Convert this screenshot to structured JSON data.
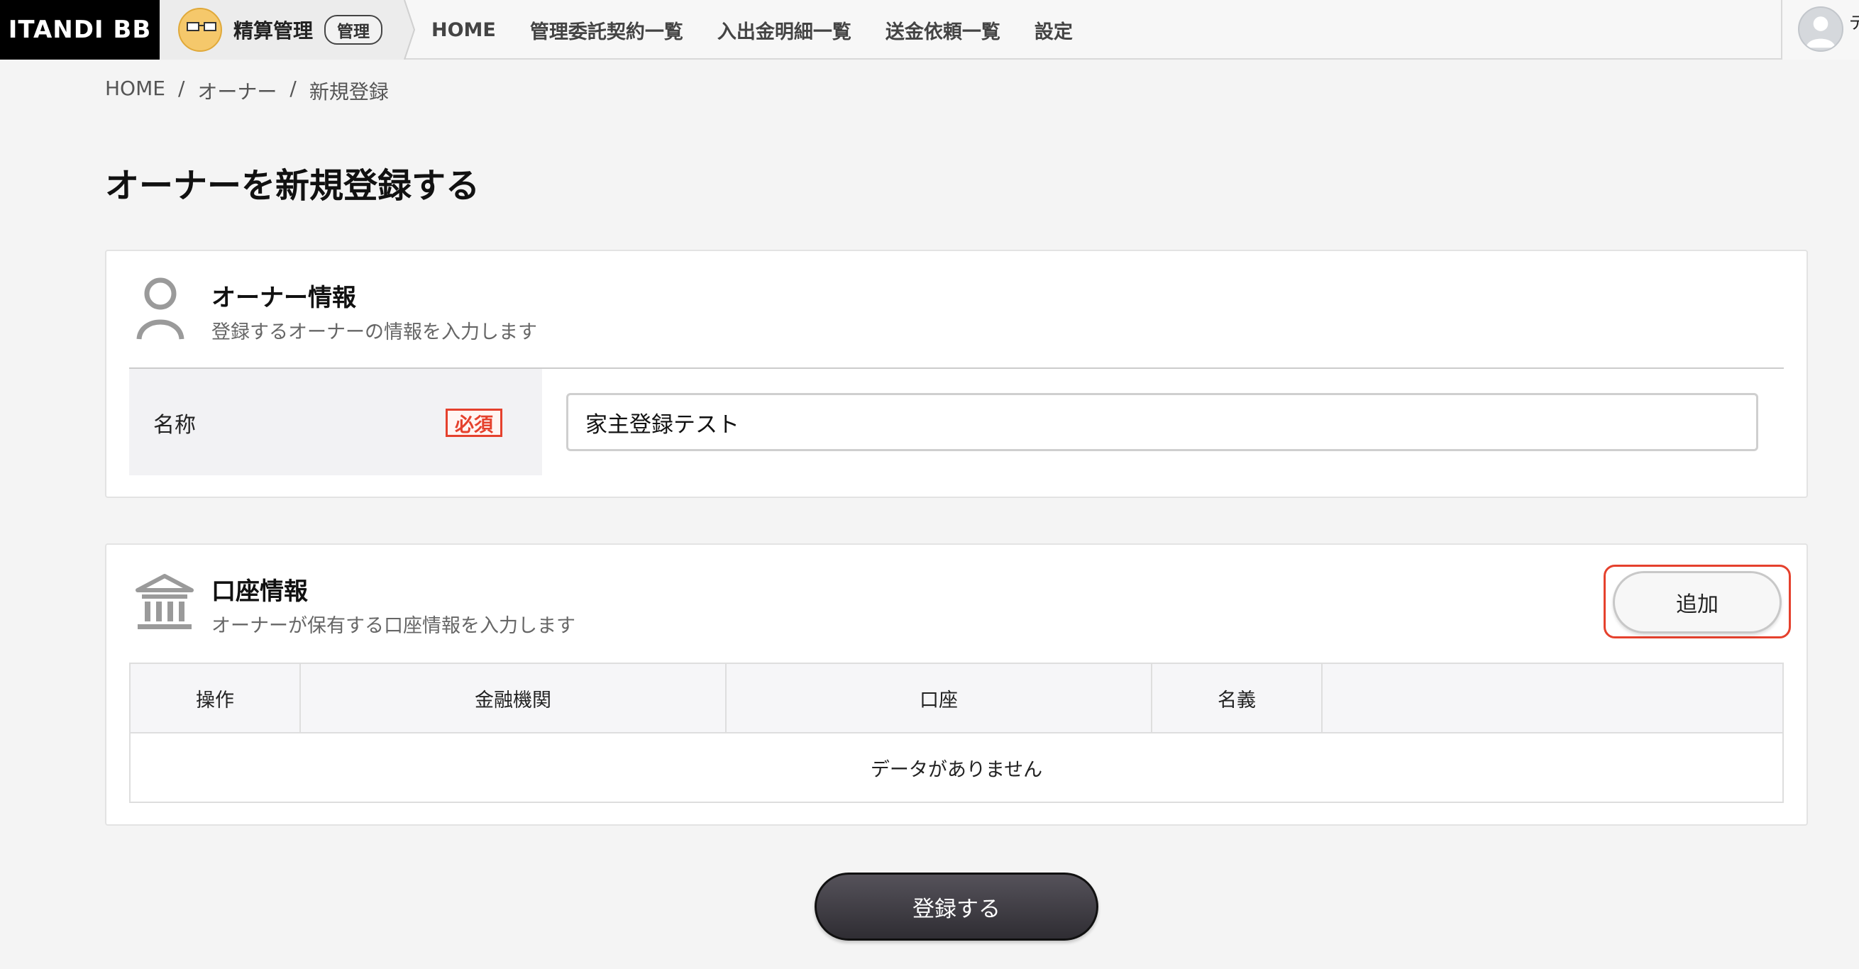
{
  "header": {
    "brand": "ITANDI BB",
    "app_name": "精算管理",
    "role_badge": "管理",
    "nav": [
      "HOME",
      "管理委託契約一覧",
      "入出金明細一覧",
      "送金依頼一覧",
      "設定"
    ],
    "user_edge_text": "デ"
  },
  "breadcrumb": [
    "HOME",
    "/",
    "オーナー",
    "/",
    "新規登録"
  ],
  "page_title": "オーナーを新規登録する",
  "owner_section": {
    "title": "オーナー情報",
    "description": "登録するオーナーの情報を入力します",
    "name_label": "名称",
    "required_label": "必須",
    "name_value": "家主登録テスト"
  },
  "account_section": {
    "title": "口座情報",
    "description": "オーナーが保有する口座情報を入力します",
    "add_button": "追加",
    "columns": [
      "操作",
      "金融機関",
      "口座",
      "名義",
      ""
    ],
    "empty_message": "データがありません"
  },
  "submit_button": "登録する",
  "colors": {
    "brand_bg": "#000000",
    "required_red": "#e5412d",
    "submit_bg": "#3a383e",
    "page_bg": "#f4f4f4"
  }
}
